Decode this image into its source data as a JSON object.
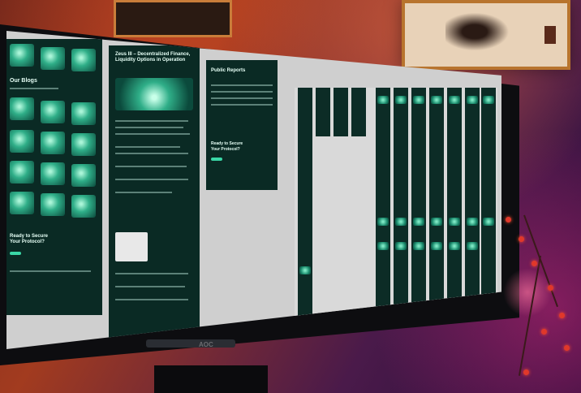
{
  "scene": {
    "monitor_brand": "AOC"
  },
  "left_panel": {
    "heading": "Our Blogs",
    "cta_heading": "Ready to Secure Your Protocol?"
  },
  "article_panel": {
    "title": "Zeus III – Decentralized Finance, Liquidity Options in Operation"
  },
  "table_panel": {
    "title": "Public Reports",
    "cta_heading": "Ready to Secure Your Protocol?"
  },
  "colors": {
    "accent": "#3ad7a6",
    "panel_bg": "#0a2a24",
    "canvas_bg": "#cfcfcf"
  }
}
